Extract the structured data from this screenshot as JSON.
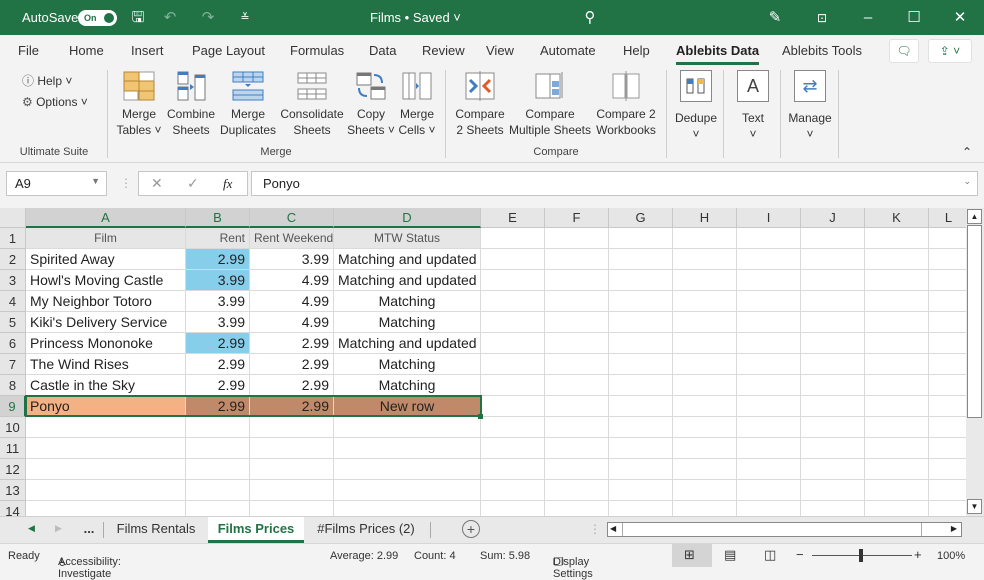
{
  "titlebar": {
    "autosave_label": "AutoSave",
    "autosave_state": "On",
    "doc_title": "Films • Saved ˅",
    "icons": [
      "save-icon",
      "undo-icon",
      "redo-icon",
      "customize-icon",
      "search-icon",
      "pen-icon",
      "ribbon-display-icon",
      "minimize-icon",
      "maximize-icon",
      "close-icon"
    ]
  },
  "menu": {
    "tabs": [
      "File",
      "Home",
      "Insert",
      "Page Layout",
      "Formulas",
      "Data",
      "Review",
      "View",
      "Automate",
      "Help",
      "Ablebits Data",
      "Ablebits Tools"
    ],
    "active": "Ablebits Data"
  },
  "ribbon": {
    "ultimate": {
      "help": "Help ˅",
      "options": "Options ˅",
      "label": "Ultimate Suite"
    },
    "merge": {
      "label": "Merge",
      "buttons": [
        {
          "l1": "Merge",
          "l2": "Tables ˅"
        },
        {
          "l1": "Combine",
          "l2": "Sheets"
        },
        {
          "l1": "Merge",
          "l2": "Duplicates"
        },
        {
          "l1": "Consolidate",
          "l2": "Sheets"
        },
        {
          "l1": "Copy",
          "l2": "Sheets ˅"
        },
        {
          "l1": "Merge",
          "l2": "Cells ˅"
        }
      ]
    },
    "compare": {
      "label": "Compare",
      "buttons": [
        {
          "l1": "Compare",
          "l2": "2 Sheets"
        },
        {
          "l1": "Compare",
          "l2": "Multiple Sheets"
        },
        {
          "l1": "Compare 2",
          "l2": "Workbooks"
        }
      ]
    },
    "dedupe": "Dedupe",
    "text": "Text",
    "text_icon": "A",
    "manage": "Manage",
    "chev": "˅"
  },
  "formula_bar": {
    "name_box": "A9",
    "fx": "fx",
    "value": "Ponyo"
  },
  "grid": {
    "columns": [
      "A",
      "B",
      "C",
      "D",
      "E",
      "F",
      "G",
      "H",
      "I",
      "J",
      "K",
      "L"
    ],
    "rows": [
      "1",
      "2",
      "3",
      "4",
      "5",
      "6",
      "7",
      "8",
      "9",
      "10",
      "11",
      "12",
      "13",
      "14"
    ],
    "header": [
      "Film",
      "Rent",
      "Rent Weekend",
      "MTW Status"
    ],
    "data": [
      [
        "Spirited Away",
        "2.99",
        "3.99",
        "Matching and updated"
      ],
      [
        "Howl's Moving Castle",
        "3.99",
        "4.99",
        "Matching and updated"
      ],
      [
        "My Neighbor Totoro",
        "3.99",
        "4.99",
        "Matching"
      ],
      [
        "Kiki's Delivery Service",
        "3.99",
        "4.99",
        "Matching"
      ],
      [
        "Princess Mononoke",
        "2.99",
        "2.99",
        "Matching and updated"
      ],
      [
        "The Wind Rises",
        "2.99",
        "2.99",
        "Matching"
      ],
      [
        "Castle in the Sky",
        "2.99",
        "2.99",
        "Matching"
      ],
      [
        "Ponyo",
        "2.99",
        "2.99",
        "New row"
      ]
    ],
    "colors": {
      "updated": "#87ceeb",
      "new_row_a": "#f4b183",
      "new_row_rest": "#c0896a",
      "selection": "#217346"
    }
  },
  "sheets": {
    "ellipsis": "...",
    "tabs": [
      "Films Rentals",
      "Films Prices",
      "#Films Prices (2)"
    ],
    "active": "Films Prices"
  },
  "status": {
    "ready": "Ready",
    "accessibility": "Accessibility: Investigate",
    "average": "Average: 2.99",
    "count": "Count: 4",
    "sum": "Sum: 5.98",
    "display": "Display Settings",
    "zoom": "100%"
  }
}
